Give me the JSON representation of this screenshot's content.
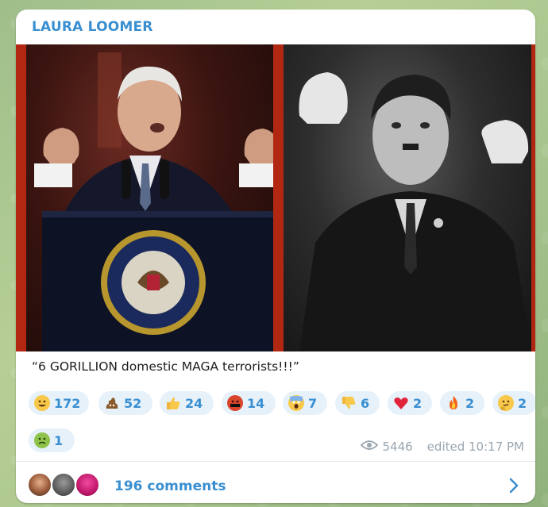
{
  "post": {
    "channel_name": "LAURA LOOMER",
    "caption": "“6 GORILLION domestic MAGA terrorists!!!”",
    "views": "5446",
    "edited_time": "edited 10:17 PM",
    "comments_label": "196 comments"
  },
  "reactions": [
    {
      "icon": "grinning-face-emoji",
      "count": "172"
    },
    {
      "icon": "pile-of-poo-emoji",
      "count": "52"
    },
    {
      "icon": "thumbs-up-emoji",
      "count": "24"
    },
    {
      "icon": "cursing-face-emoji",
      "count": "14"
    },
    {
      "icon": "screaming-face-emoji",
      "count": "7"
    },
    {
      "icon": "thumbs-down-emoji",
      "count": "6"
    },
    {
      "icon": "red-heart-emoji",
      "count": "2"
    },
    {
      "icon": "fire-emoji",
      "count": "2"
    },
    {
      "icon": "thinking-face-emoji",
      "count": "2"
    },
    {
      "icon": "nauseated-face-emoji",
      "count": "1"
    }
  ],
  "colors": {
    "accent": "#3a8fd1",
    "reaction_bg": "#e6f1fa",
    "meta_gray": "#9aa6b1",
    "media_border_red": "#b22712"
  }
}
